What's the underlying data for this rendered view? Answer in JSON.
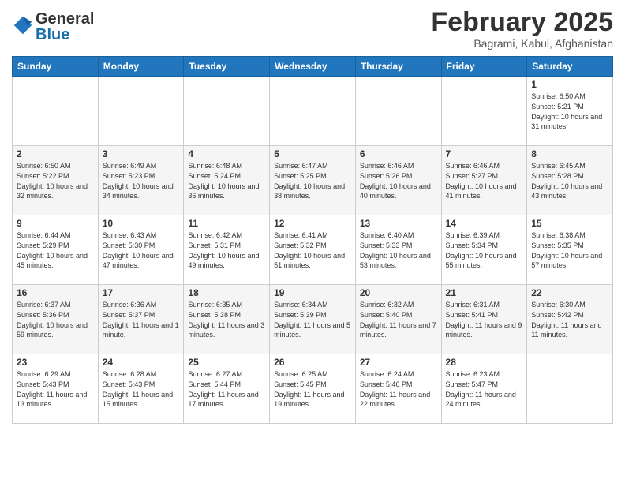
{
  "header": {
    "logo_general": "General",
    "logo_blue": "Blue",
    "month": "February 2025",
    "location": "Bagrami, Kabul, Afghanistan"
  },
  "weekdays": [
    "Sunday",
    "Monday",
    "Tuesday",
    "Wednesday",
    "Thursday",
    "Friday",
    "Saturday"
  ],
  "weeks": [
    [
      {
        "day": "",
        "info": ""
      },
      {
        "day": "",
        "info": ""
      },
      {
        "day": "",
        "info": ""
      },
      {
        "day": "",
        "info": ""
      },
      {
        "day": "",
        "info": ""
      },
      {
        "day": "",
        "info": ""
      },
      {
        "day": "1",
        "info": "Sunrise: 6:50 AM\nSunset: 5:21 PM\nDaylight: 10 hours and 31 minutes."
      }
    ],
    [
      {
        "day": "2",
        "info": "Sunrise: 6:50 AM\nSunset: 5:22 PM\nDaylight: 10 hours and 32 minutes."
      },
      {
        "day": "3",
        "info": "Sunrise: 6:49 AM\nSunset: 5:23 PM\nDaylight: 10 hours and 34 minutes."
      },
      {
        "day": "4",
        "info": "Sunrise: 6:48 AM\nSunset: 5:24 PM\nDaylight: 10 hours and 36 minutes."
      },
      {
        "day": "5",
        "info": "Sunrise: 6:47 AM\nSunset: 5:25 PM\nDaylight: 10 hours and 38 minutes."
      },
      {
        "day": "6",
        "info": "Sunrise: 6:46 AM\nSunset: 5:26 PM\nDaylight: 10 hours and 40 minutes."
      },
      {
        "day": "7",
        "info": "Sunrise: 6:46 AM\nSunset: 5:27 PM\nDaylight: 10 hours and 41 minutes."
      },
      {
        "day": "8",
        "info": "Sunrise: 6:45 AM\nSunset: 5:28 PM\nDaylight: 10 hours and 43 minutes."
      }
    ],
    [
      {
        "day": "9",
        "info": "Sunrise: 6:44 AM\nSunset: 5:29 PM\nDaylight: 10 hours and 45 minutes."
      },
      {
        "day": "10",
        "info": "Sunrise: 6:43 AM\nSunset: 5:30 PM\nDaylight: 10 hours and 47 minutes."
      },
      {
        "day": "11",
        "info": "Sunrise: 6:42 AM\nSunset: 5:31 PM\nDaylight: 10 hours and 49 minutes."
      },
      {
        "day": "12",
        "info": "Sunrise: 6:41 AM\nSunset: 5:32 PM\nDaylight: 10 hours and 51 minutes."
      },
      {
        "day": "13",
        "info": "Sunrise: 6:40 AM\nSunset: 5:33 PM\nDaylight: 10 hours and 53 minutes."
      },
      {
        "day": "14",
        "info": "Sunrise: 6:39 AM\nSunset: 5:34 PM\nDaylight: 10 hours and 55 minutes."
      },
      {
        "day": "15",
        "info": "Sunrise: 6:38 AM\nSunset: 5:35 PM\nDaylight: 10 hours and 57 minutes."
      }
    ],
    [
      {
        "day": "16",
        "info": "Sunrise: 6:37 AM\nSunset: 5:36 PM\nDaylight: 10 hours and 59 minutes."
      },
      {
        "day": "17",
        "info": "Sunrise: 6:36 AM\nSunset: 5:37 PM\nDaylight: 11 hours and 1 minute."
      },
      {
        "day": "18",
        "info": "Sunrise: 6:35 AM\nSunset: 5:38 PM\nDaylight: 11 hours and 3 minutes."
      },
      {
        "day": "19",
        "info": "Sunrise: 6:34 AM\nSunset: 5:39 PM\nDaylight: 11 hours and 5 minutes."
      },
      {
        "day": "20",
        "info": "Sunrise: 6:32 AM\nSunset: 5:40 PM\nDaylight: 11 hours and 7 minutes."
      },
      {
        "day": "21",
        "info": "Sunrise: 6:31 AM\nSunset: 5:41 PM\nDaylight: 11 hours and 9 minutes."
      },
      {
        "day": "22",
        "info": "Sunrise: 6:30 AM\nSunset: 5:42 PM\nDaylight: 11 hours and 11 minutes."
      }
    ],
    [
      {
        "day": "23",
        "info": "Sunrise: 6:29 AM\nSunset: 5:43 PM\nDaylight: 11 hours and 13 minutes."
      },
      {
        "day": "24",
        "info": "Sunrise: 6:28 AM\nSunset: 5:43 PM\nDaylight: 11 hours and 15 minutes."
      },
      {
        "day": "25",
        "info": "Sunrise: 6:27 AM\nSunset: 5:44 PM\nDaylight: 11 hours and 17 minutes."
      },
      {
        "day": "26",
        "info": "Sunrise: 6:25 AM\nSunset: 5:45 PM\nDaylight: 11 hours and 19 minutes."
      },
      {
        "day": "27",
        "info": "Sunrise: 6:24 AM\nSunset: 5:46 PM\nDaylight: 11 hours and 22 minutes."
      },
      {
        "day": "28",
        "info": "Sunrise: 6:23 AM\nSunset: 5:47 PM\nDaylight: 11 hours and 24 minutes."
      },
      {
        "day": "",
        "info": ""
      }
    ]
  ]
}
